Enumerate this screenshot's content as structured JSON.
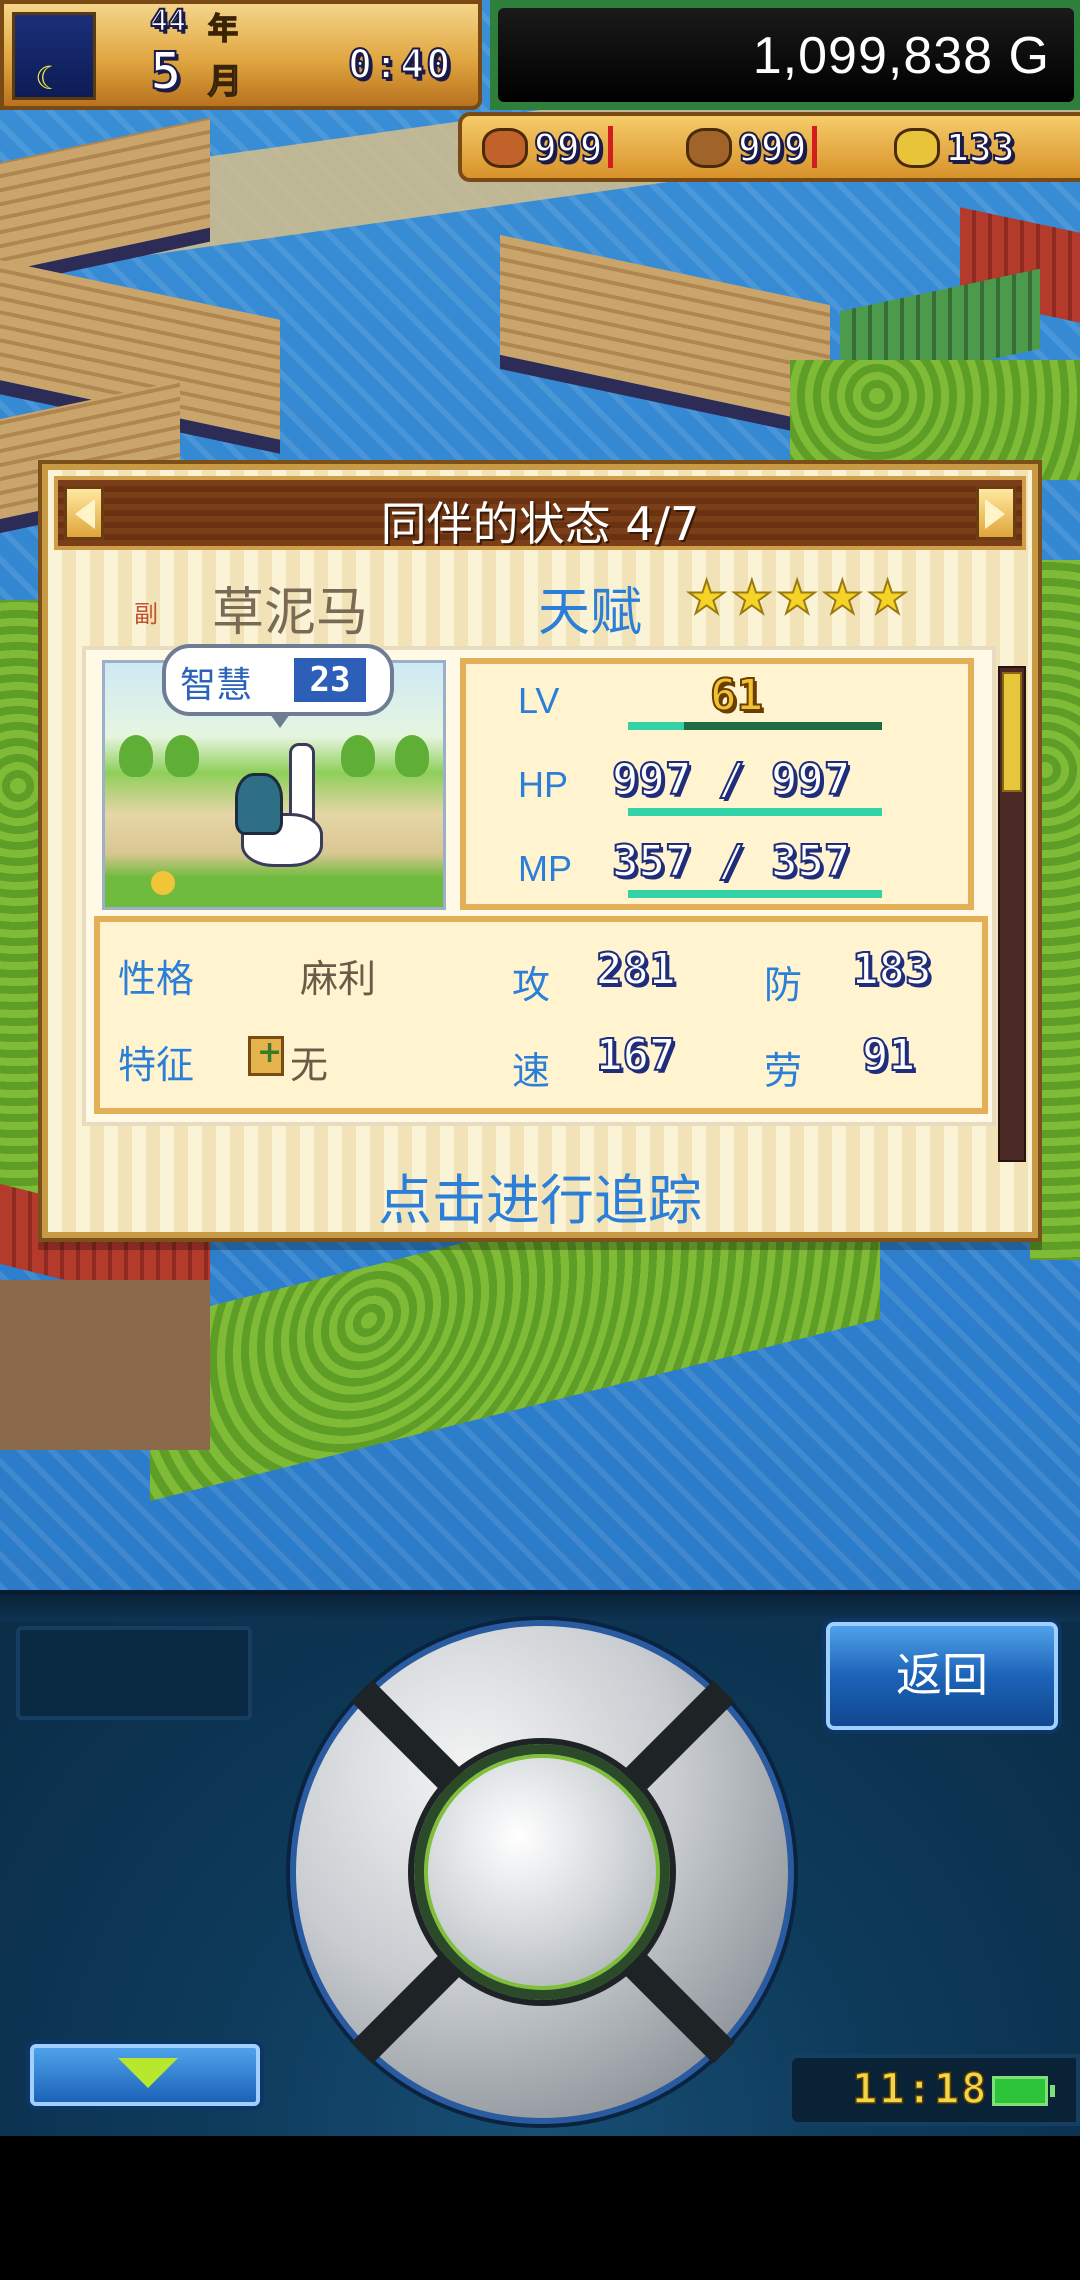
{
  "hud": {
    "year": "44",
    "year_label": "年",
    "month": "5",
    "month_label": "月",
    "clock": "0:40",
    "money": "1,099,838 G"
  },
  "resources": [
    {
      "icon": "food-icon",
      "value": "999",
      "color": "#c0622a"
    },
    {
      "icon": "wood-icon",
      "value": "999",
      "color": "#a0642a"
    },
    {
      "icon": "gold-coin-icon",
      "value": "133",
      "color": "#e8c43a"
    }
  ],
  "panel": {
    "title": "同伴的状态 4/7",
    "sub_mark": "副",
    "companion_name": "草泥马",
    "talent_label": "天赋",
    "stars": 5,
    "speech_label": "智慧",
    "speech_value": "23",
    "stats": {
      "lv_label": "LV",
      "lv_value": "61",
      "hp_label": "HP",
      "hp_value": "997 / 997",
      "mp_label": "MP",
      "mp_value": "357 / 357"
    },
    "attributes": {
      "personality_label": "性格",
      "personality_value": "麻利",
      "trait_label": "特征",
      "trait_value": "无",
      "attack_label": "攻",
      "attack_value": "281",
      "defense_label": "防",
      "defense_value": "183",
      "speed_label": "速",
      "speed_value": "167",
      "labor_label": "劳",
      "labor_value": "91"
    },
    "track_link": "点击进行追踪"
  },
  "controller": {
    "back_label": "返回",
    "status_time": "11:18"
  },
  "colors": {
    "accent_blue": "#2b7fd8",
    "panel_border": "#c99a44",
    "header_brown": "#7a3e18"
  }
}
